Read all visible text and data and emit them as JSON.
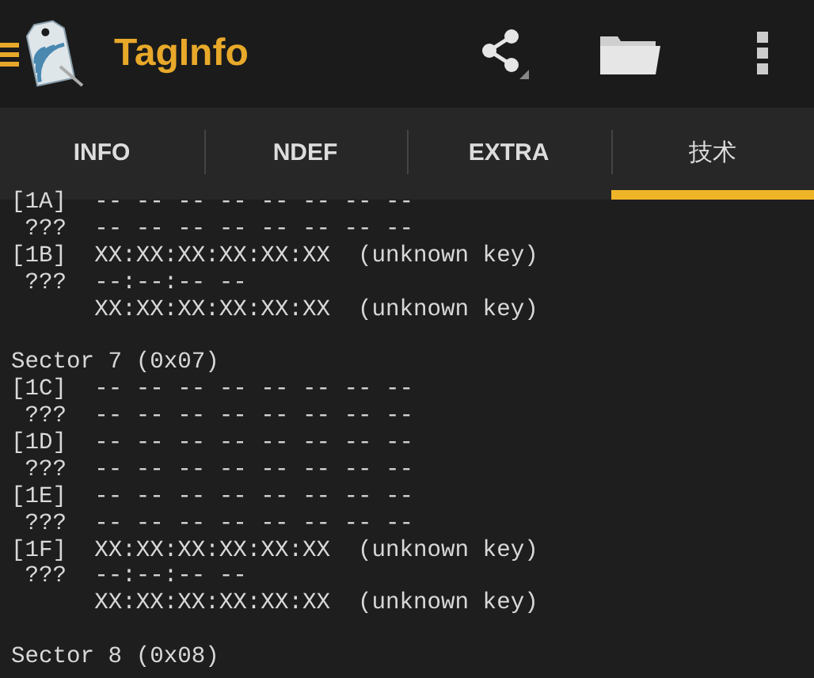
{
  "app_bar": {
    "title": "TagInfo"
  },
  "tabs": [
    {
      "label": "INFO",
      "selected": false
    },
    {
      "label": "NDEF",
      "selected": false
    },
    {
      "label": "EXTRA",
      "selected": false
    },
    {
      "label": "技术",
      "selected": true
    }
  ],
  "lines": [
    {
      "kind": "row",
      "label": "[1A]",
      "value": "-- -- -- -- -- -- -- --"
    },
    {
      "kind": "row",
      "label": " ???",
      "value": "-- -- -- -- -- -- -- --"
    },
    {
      "kind": "row",
      "label": "[1B]",
      "value": "XX:XX:XX:XX:XX:XX  (unknown key)"
    },
    {
      "kind": "row",
      "label": " ???",
      "value": "--:--:-- --"
    },
    {
      "kind": "row",
      "value": "XX:XX:XX:XX:XX:XX  (unknown key)"
    },
    {
      "kind": "blank"
    },
    {
      "kind": "heading",
      "text": "Sector 7 (0x07)"
    },
    {
      "kind": "row",
      "label": "[1C]",
      "value": "-- -- -- -- -- -- -- --"
    },
    {
      "kind": "row",
      "label": " ???",
      "value": "-- -- -- -- -- -- -- --"
    },
    {
      "kind": "row",
      "label": "[1D]",
      "value": "-- -- -- -- -- -- -- --"
    },
    {
      "kind": "row",
      "label": " ???",
      "value": "-- -- -- -- -- -- -- --"
    },
    {
      "kind": "row",
      "label": "[1E]",
      "value": "-- -- -- -- -- -- -- --"
    },
    {
      "kind": "row",
      "label": " ???",
      "value": "-- -- -- -- -- -- -- --"
    },
    {
      "kind": "row",
      "label": "[1F]",
      "value": "XX:XX:XX:XX:XX:XX  (unknown key)"
    },
    {
      "kind": "row",
      "label": " ???",
      "value": "--:--:-- --"
    },
    {
      "kind": "row",
      "value": "XX:XX:XX:XX:XX:XX  (unknown key)"
    },
    {
      "kind": "blank"
    },
    {
      "kind": "heading",
      "text": "Sector 8 (0x08)"
    }
  ]
}
